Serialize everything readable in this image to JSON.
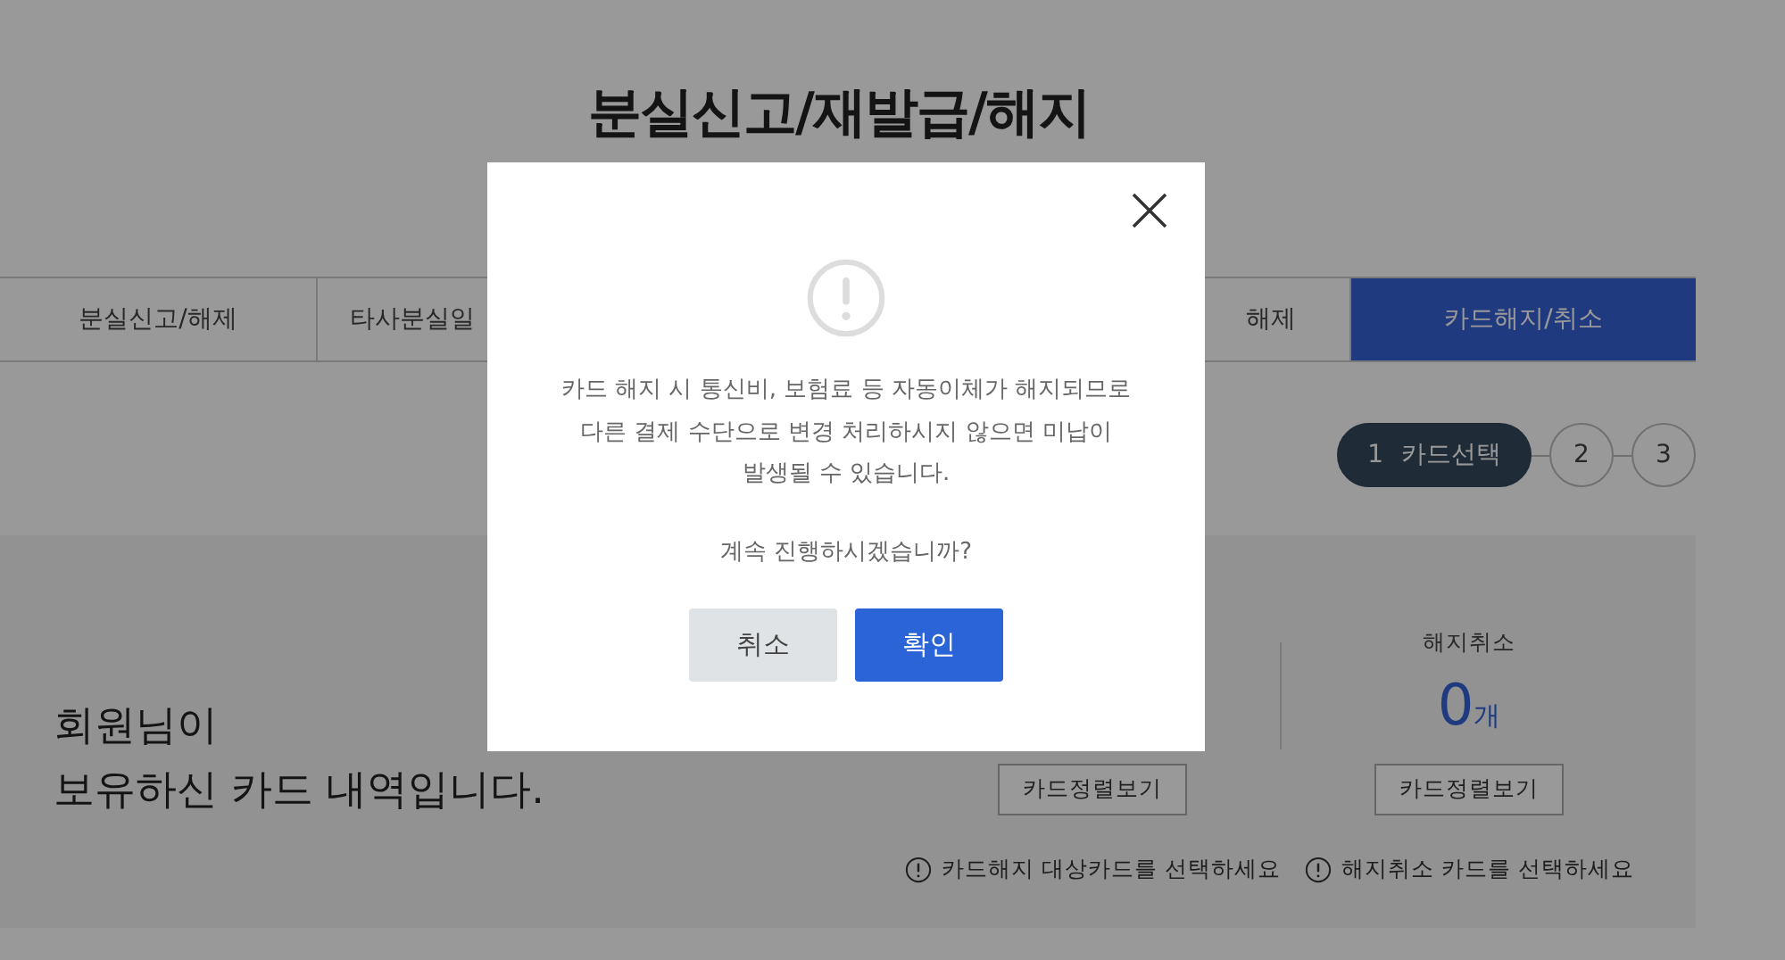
{
  "page": {
    "title": "분실신고/재발급/해지"
  },
  "tabs": [
    {
      "label": "분실신고/해제",
      "selected": false
    },
    {
      "label": "타사분실일",
      "selected": false
    },
    {
      "label": "해제",
      "selected": false
    },
    {
      "label": "카드해지/취소",
      "selected": true
    }
  ],
  "steps": [
    {
      "number": "1",
      "label": "카드선택",
      "selected": true
    },
    {
      "number": "2",
      "selected": false
    },
    {
      "number": "3",
      "selected": false
    }
  ],
  "summary": {
    "greeting": "회원님이",
    "subtitle": "보유하신 카드 내역입니다.",
    "columns": [
      {
        "button": "카드정렬보기",
        "note": "카드해지 대상카드를 선택하세요"
      },
      {
        "label": "해지취소",
        "count": "0",
        "unit": "개",
        "button": "카드정렬보기",
        "note": "해지취소 카드를 선택하세요"
      }
    ]
  },
  "dialog": {
    "message_lines": [
      "카드 해지 시 통신비, 보험료 등 자동이체가 해지되므로",
      "다른 결제 수단으로 변경 처리하시지 않으면 미납이",
      "발생될 수 있습니다."
    ],
    "question": "계속 진행하시겠습니까?",
    "buttons": [
      {
        "label": "취소",
        "kind": "secondary"
      },
      {
        "label": "확인",
        "kind": "primary"
      }
    ]
  }
}
